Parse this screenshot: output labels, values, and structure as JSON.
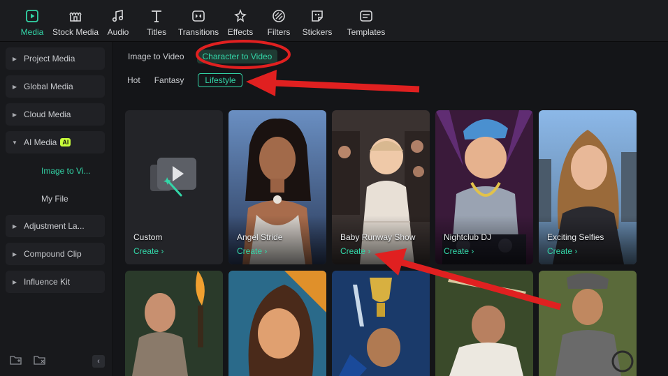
{
  "toolbar": {
    "items": [
      {
        "label": "Media",
        "icon": "media-icon"
      },
      {
        "label": "Stock Media",
        "icon": "stock-media-icon"
      },
      {
        "label": "Audio",
        "icon": "audio-icon"
      },
      {
        "label": "Titles",
        "icon": "titles-icon"
      },
      {
        "label": "Transitions",
        "icon": "transitions-icon"
      },
      {
        "label": "Effects",
        "icon": "effects-icon"
      },
      {
        "label": "Filters",
        "icon": "filters-icon"
      },
      {
        "label": "Stickers",
        "icon": "stickers-icon"
      },
      {
        "label": "Templates",
        "icon": "templates-icon"
      }
    ]
  },
  "sidebar": {
    "items": [
      {
        "label": "Project Media"
      },
      {
        "label": "Global Media"
      },
      {
        "label": "Cloud Media"
      },
      {
        "label": "AI Media",
        "badge": "AI"
      },
      {
        "label": "Adjustment La..."
      },
      {
        "label": "Compound Clip"
      },
      {
        "label": "Influence Kit"
      }
    ],
    "sub_items": [
      {
        "label": "Image to Vi..."
      },
      {
        "label": "My File"
      }
    ]
  },
  "main": {
    "tabs": [
      {
        "label": "Image to Video"
      },
      {
        "label": "Character to Video"
      }
    ],
    "categories": [
      {
        "label": "Hot"
      },
      {
        "label": "Fantasy"
      },
      {
        "label": "Lifestyle"
      }
    ],
    "cards": [
      {
        "title": "Custom",
        "action": "Create"
      },
      {
        "title": "Angel Stride",
        "action": "Create"
      },
      {
        "title": "Baby Runway Show",
        "action": "Create"
      },
      {
        "title": "Nightclub DJ",
        "action": "Create"
      },
      {
        "title": "Exciting Selfies",
        "action": "Create"
      }
    ]
  },
  "colors": {
    "accent": "#33d6a8",
    "annotation": "#e02020",
    "ai_badge": "#c9ff3a"
  }
}
